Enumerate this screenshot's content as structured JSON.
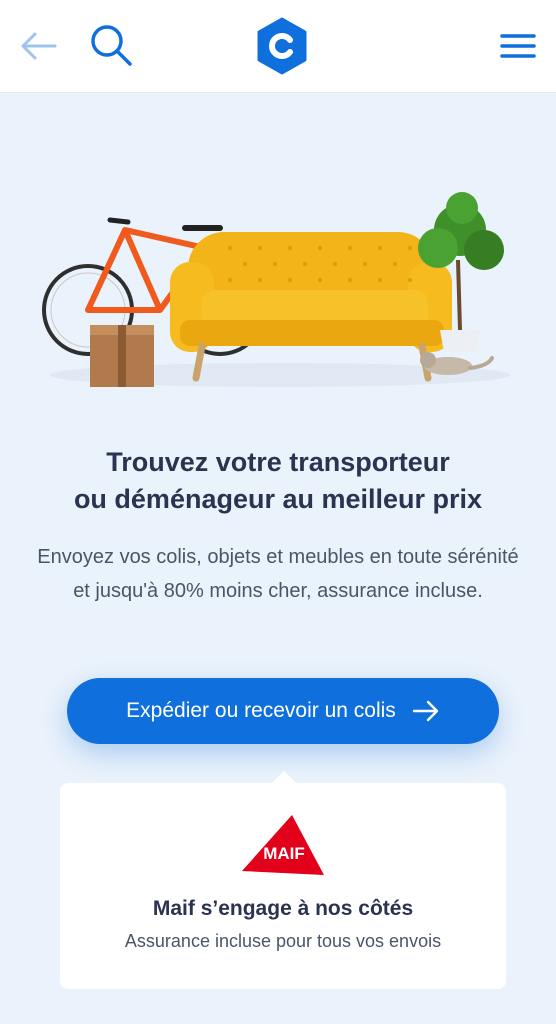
{
  "header": {
    "back_icon": "arrow-left-icon",
    "search_icon": "search-icon",
    "logo_icon": "hexagon-logo-icon",
    "menu_icon": "hamburger-menu-icon",
    "accent": "#0f6fdc"
  },
  "hero": {
    "headline_line1": "Trouvez votre transporteur",
    "headline_line2": "ou déménageur au meilleur prix",
    "description": "Envoyez vos colis, objets et meubles en toute sérénité et jusqu'à 80% moins cher, assurance incluse."
  },
  "cta": {
    "label": "Expédier ou recevoir un colis",
    "arrow_icon": "arrow-right-icon",
    "color": "#0f6fdc"
  },
  "insurance_card": {
    "logo_text": "MAIF",
    "title": "Maif s’engage à nos côtés",
    "subtitle": "Assurance incluse pour tous vos envois",
    "logo_color": "#e3001b"
  }
}
